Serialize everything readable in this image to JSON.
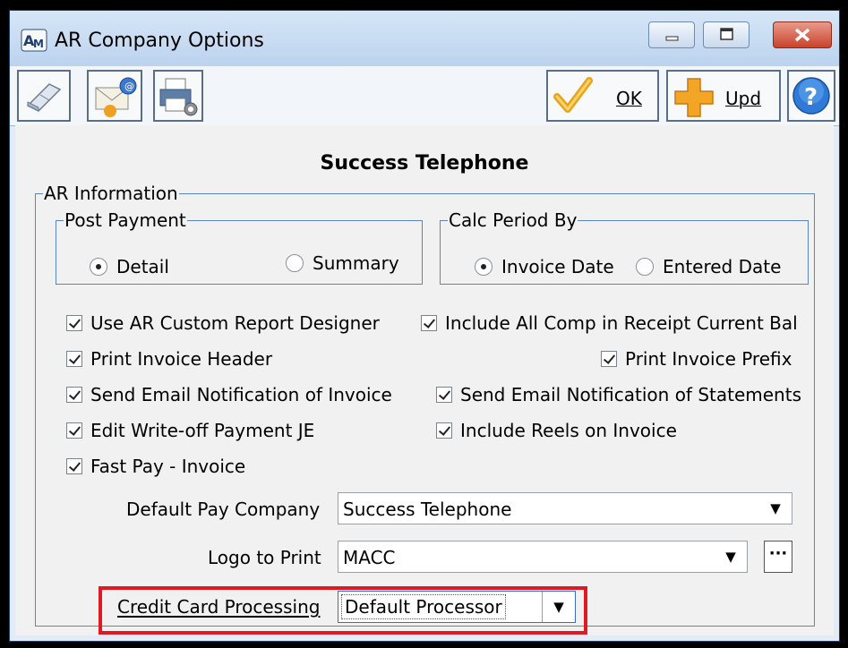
{
  "window": {
    "title": "AR Company Options",
    "controls": [
      "minimize",
      "maximize",
      "close"
    ]
  },
  "toolbar": {
    "left_buttons": [
      "eraser-icon",
      "email-icon",
      "print-settings-icon"
    ],
    "ok_label": "OK",
    "upd_label": "Upd",
    "help_icon": "help-icon"
  },
  "company_name": "Success Telephone",
  "ar_information": {
    "legend": "AR Information",
    "post_payment": {
      "legend": "Post Payment",
      "options": [
        {
          "label": "Detail",
          "selected": true
        },
        {
          "label": "Summary",
          "selected": false
        }
      ]
    },
    "calc_period": {
      "legend": "Calc Period By",
      "options": [
        {
          "label": "Invoice Date",
          "selected": true
        },
        {
          "label": "Entered Date",
          "selected": false
        }
      ]
    },
    "checkboxes": {
      "use_ar_custom": {
        "label": "Use AR Custom Report Designer",
        "checked": true
      },
      "include_all_comp": {
        "label": "Include All Comp in Receipt Current Bal",
        "checked": true
      },
      "print_invoice_header": {
        "label": "Print Invoice Header",
        "checked": true
      },
      "print_invoice_prefix": {
        "label": "Print Invoice Prefix",
        "checked": true
      },
      "send_email_invoice": {
        "label": "Send Email Notification of Invoice",
        "checked": true
      },
      "send_email_statements": {
        "label": "Send Email Notification of Statements",
        "checked": true
      },
      "edit_writeoff": {
        "label": "Edit Write-off Payment JE",
        "checked": true
      },
      "include_reels": {
        "label": "Include Reels on Invoice",
        "checked": true
      },
      "fast_pay": {
        "label": "Fast Pay - Invoice",
        "checked": true
      }
    },
    "default_pay_company": {
      "label": "Default Pay Company",
      "value": "Success Telephone"
    },
    "logo_to_print": {
      "label": "Logo to Print",
      "value": "MACC",
      "browse_label": "···"
    },
    "credit_card_processing": {
      "label": "Credit Card Processing",
      "value": "Default Processor"
    }
  },
  "colors": {
    "highlight_box": "#e01a22",
    "group_border": "#5a86bf",
    "titlebar": "#bcd3ee"
  }
}
